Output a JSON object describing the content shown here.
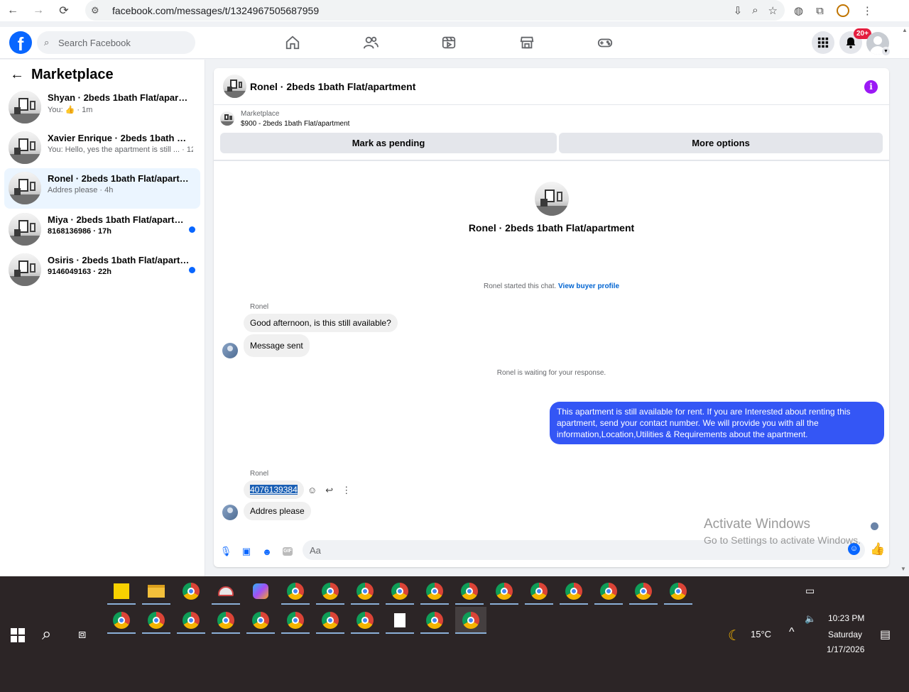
{
  "browser": {
    "url": "facebook.com/messages/t/1324967505687959"
  },
  "facebook": {
    "search_placeholder": "Search Facebook",
    "notification_count": "20+"
  },
  "sidebar": {
    "title": "Marketplace",
    "conversations": [
      {
        "name": "Shyan · 2beds 1bath Flat/apartment",
        "snippet": "You: 👍 · 1m",
        "unread": false,
        "active": false
      },
      {
        "name": "Xavier Enrique · 2beds 1bath Flat/a...",
        "snippet": "You: Hello, yes the apartment is still ... · 12m",
        "unread": false,
        "active": false
      },
      {
        "name": "Ronel · 2beds 1bath Flat/apartment",
        "snippet": "Addres please · 4h",
        "unread": false,
        "active": true
      },
      {
        "name": "Miya · 2beds 1bath Flat/apartment",
        "snippet": "8168136986 · 17h",
        "unread": true,
        "active": false
      },
      {
        "name": "Osiris · 2beds 1bath Flat/apartme...",
        "snippet": "9146049163 · 22h",
        "unread": true,
        "active": false
      }
    ]
  },
  "chat": {
    "header_title": "Ronel · 2beds 1bath Flat/apartment",
    "marketplace_label": "Marketplace",
    "listing": "$900 - 2beds 1bath Flat/apartment",
    "mark_pending": "Mark as pending",
    "more_options": "More options",
    "profile_name": "Ronel · 2beds 1bath Flat/apartment",
    "started_text": "Ronel started this chat.",
    "view_buyer": "View buyer profile",
    "sender1": "Ronel",
    "msg1": "Good afternoon, is this still available?",
    "msg2": "Message sent",
    "waiting": "Ronel is waiting for your response.",
    "outgoing": "This apartment is still available for rent. If you are Interested about renting this apartment, send your contact number. We will provide you with all the information,Location,Utilities & Requirements about the apartment.",
    "sender2": "Ronel",
    "msg3": "4076139384",
    "msg4": "Addres please",
    "composer_placeholder": "Aa"
  },
  "watermark": {
    "line1": "Activate Windows",
    "line2": "Go to Settings to activate Windows."
  },
  "taskbar": {
    "weather": "15°C",
    "time": "10:23 PM",
    "day": "Saturday",
    "date": "1/17/2026"
  }
}
